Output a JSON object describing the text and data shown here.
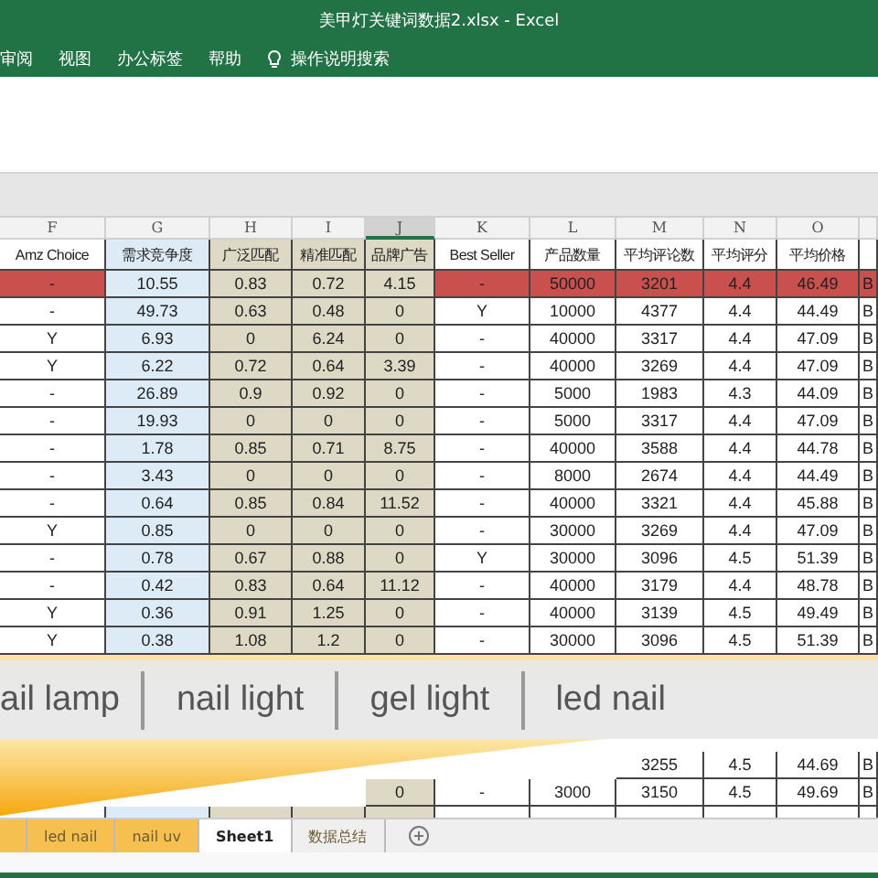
{
  "window": {
    "title": "美甲灯关键词数据2.xlsx  -  Excel"
  },
  "ribbon_tabs": [
    "审阅",
    "视图",
    "办公标签",
    "帮助"
  ],
  "tell_me": "操作说明搜索",
  "columns": [
    {
      "letter": "F",
      "heading": "Amz Choice",
      "selected": false
    },
    {
      "letter": "G",
      "heading": "需求竞争度",
      "selected": false,
      "color": "#ddebf7"
    },
    {
      "letter": "H",
      "heading": "广泛匹配",
      "selected": false,
      "color": "#ddd9c4"
    },
    {
      "letter": "I",
      "heading": "精准匹配",
      "selected": false,
      "color": "#ddd9c4"
    },
    {
      "letter": "J",
      "heading": "品牌广告",
      "selected": true,
      "color": "#ddd9c4"
    },
    {
      "letter": "K",
      "heading": "Best Seller",
      "selected": false
    },
    {
      "letter": "L",
      "heading": "产品数量",
      "selected": false
    },
    {
      "letter": "M",
      "heading": "平均评论数",
      "selected": false
    },
    {
      "letter": "N",
      "heading": "平均评分",
      "selected": false
    },
    {
      "letter": "O",
      "heading": "平均价格",
      "selected": false
    },
    {
      "selected": false
    }
  ],
  "rows": [
    {
      "selected": true,
      "cells": [
        "-",
        "10.55",
        "0.83",
        "0.72",
        "4.15",
        "-",
        "50000",
        "3201",
        "4.4",
        "46.49",
        "B"
      ]
    },
    {
      "selected": false,
      "cells": [
        "-",
        "49.73",
        "0.63",
        "0.48",
        "0",
        "Y",
        "10000",
        "4377",
        "4.4",
        "44.49",
        "B"
      ]
    },
    {
      "selected": false,
      "cells": [
        "Y",
        "6.93",
        "0",
        "6.24",
        "0",
        "-",
        "40000",
        "3317",
        "4.4",
        "47.09",
        "B"
      ]
    },
    {
      "selected": false,
      "cells": [
        "Y",
        "6.22",
        "0.72",
        "0.64",
        "3.39",
        "-",
        "40000",
        "3269",
        "4.4",
        "47.09",
        "B"
      ]
    },
    {
      "selected": false,
      "cells": [
        "-",
        "26.89",
        "0.9",
        "0.92",
        "0",
        "-",
        "5000",
        "1983",
        "4.3",
        "44.09",
        "B"
      ]
    },
    {
      "selected": false,
      "cells": [
        "-",
        "19.93",
        "0",
        "0",
        "0",
        "-",
        "5000",
        "3317",
        "4.4",
        "47.09",
        "B"
      ]
    },
    {
      "selected": false,
      "cells": [
        "-",
        "1.78",
        "0.85",
        "0.71",
        "8.75",
        "-",
        "40000",
        "3588",
        "4.4",
        "44.78",
        "B"
      ]
    },
    {
      "selected": false,
      "cells": [
        "-",
        "3.43",
        "0",
        "0",
        "0",
        "-",
        "8000",
        "2674",
        "4.4",
        "44.49",
        "B"
      ]
    },
    {
      "selected": false,
      "cells": [
        "-",
        "0.64",
        "0.85",
        "0.84",
        "11.52",
        "-",
        "40000",
        "3321",
        "4.4",
        "45.88",
        "B"
      ]
    },
    {
      "selected": false,
      "cells": [
        "Y",
        "0.85",
        "0",
        "0",
        "0",
        "-",
        "30000",
        "3269",
        "4.4",
        "47.09",
        "B"
      ]
    },
    {
      "selected": false,
      "cells": [
        "-",
        "0.78",
        "0.67",
        "0.88",
        "0",
        "Y",
        "30000",
        "3096",
        "4.5",
        "51.39",
        "B"
      ]
    },
    {
      "selected": false,
      "cells": [
        "-",
        "0.42",
        "0.83",
        "0.64",
        "11.12",
        "-",
        "40000",
        "3179",
        "4.4",
        "48.78",
        "B"
      ]
    },
    {
      "selected": false,
      "cells": [
        "Y",
        "0.36",
        "0.91",
        "1.25",
        "0",
        "-",
        "40000",
        "3139",
        "4.5",
        "49.49",
        "B"
      ]
    },
    {
      "selected": false,
      "cells": [
        "Y",
        "0.38",
        "1.08",
        "1.2",
        "0",
        "-",
        "30000",
        "3096",
        "4.5",
        "51.39",
        "B"
      ]
    }
  ],
  "rows_below": [
    {
      "selected": false,
      "cells": [
        null,
        null,
        null,
        null,
        null,
        null,
        null,
        "3255",
        "4.5",
        "44.69",
        "B"
      ]
    },
    {
      "selected": false,
      "cells": [
        null,
        null,
        null,
        null,
        "0",
        "-",
        "3000",
        "3150",
        "4.5",
        "49.69",
        "B"
      ]
    }
  ],
  "banner": {
    "keywords": [
      "ail lamp",
      "nail light",
      "gel light",
      "led nail"
    ]
  },
  "sheet_tabs": [
    {
      "label": "led nail",
      "selected": false,
      "color": "#f5c04f"
    },
    {
      "label": "nail uv",
      "selected": false,
      "color": "#f5c04f"
    },
    {
      "label": "Sheet1",
      "selected": true
    },
    {
      "label": "数据总结",
      "selected": false
    }
  ]
}
